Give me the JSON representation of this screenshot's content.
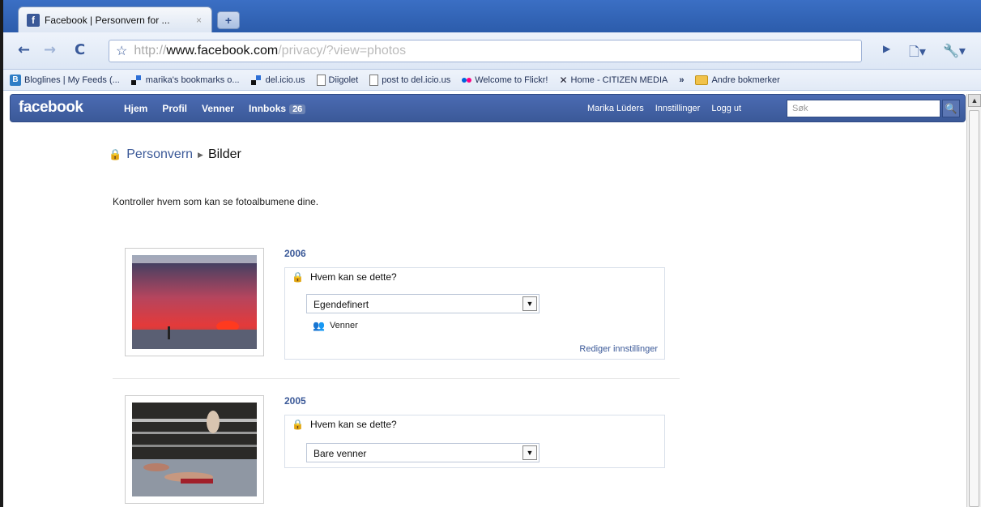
{
  "browser": {
    "tab_title": "Facebook | Personvern for ...",
    "tab_close": "×",
    "new_tab": "+",
    "url_scheme": "http://",
    "url_host": "www.facebook.com",
    "url_path": "/privacy/?view=photos",
    "bookmarks": [
      {
        "label": "Bloglines | My Feeds (...",
        "icon": "bloglines-icon"
      },
      {
        "label": "marika's bookmarks o...",
        "icon": "delicious-icon"
      },
      {
        "label": "del.icio.us",
        "icon": "delicious-icon"
      },
      {
        "label": "Diigolet",
        "icon": "page-icon"
      },
      {
        "label": "post to del.icio.us",
        "icon": "page-icon"
      },
      {
        "label": "Welcome to Flickr!",
        "icon": "flickr-icon"
      },
      {
        "label": "Home - CITIZEN MEDIA",
        "icon": "citizen-icon"
      }
    ],
    "bookmarks_more": "»",
    "other_bookmarks": "Andre bokmerker"
  },
  "facebook": {
    "logo": "facebook",
    "nav": [
      {
        "label": "Hjem"
      },
      {
        "label": "Profil"
      },
      {
        "label": "Venner"
      },
      {
        "label": "Innboks"
      }
    ],
    "inbox_count": "26",
    "user_name": "Marika Lüders",
    "settings": "Innstillinger",
    "logout": "Logg ut",
    "search_placeholder": "Søk"
  },
  "page": {
    "breadcrumb_root": "Personvern",
    "breadcrumb_current": "Bilder",
    "intro": "Kontroller hvem som kan se fotoalbumene dine."
  },
  "albums": [
    {
      "year": "2006",
      "question": "Hvem kan se dette?",
      "selected": "Egendefinert",
      "friends": "Venner",
      "edit": "Rediger innstillinger"
    },
    {
      "year": "2005",
      "question": "Hvem kan se dette?",
      "selected": "Bare venner"
    }
  ]
}
